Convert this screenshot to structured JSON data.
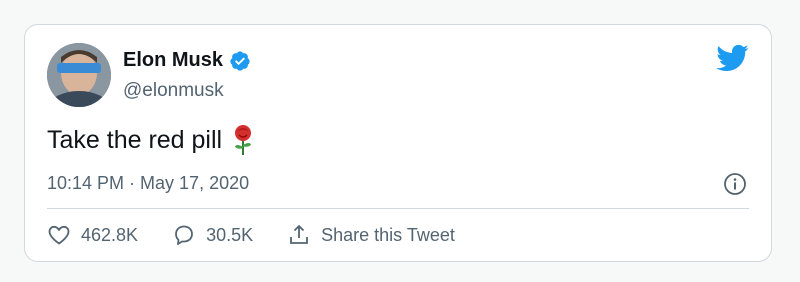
{
  "tweet": {
    "author": {
      "name": "Elon Musk",
      "handle": "@elonmusk",
      "verified": true,
      "avatar_icon": "profile-photo"
    },
    "text": "Take the red pill",
    "emoji": "rose",
    "timestamp": "10:14 PM · May 17, 2020",
    "actions": {
      "likes": "462.8K",
      "replies": "30.5K",
      "share_label": "Share this Tweet"
    }
  },
  "icons": {
    "brand": "twitter-bird-icon",
    "verified": "verified-badge-icon",
    "info": "info-icon",
    "like": "heart-icon",
    "reply": "reply-bubble-icon",
    "share": "share-icon"
  },
  "colors": {
    "brand_blue": "#1d9bf0",
    "text_primary": "#0f1419",
    "text_secondary": "#536471",
    "border": "#cfd9de"
  }
}
